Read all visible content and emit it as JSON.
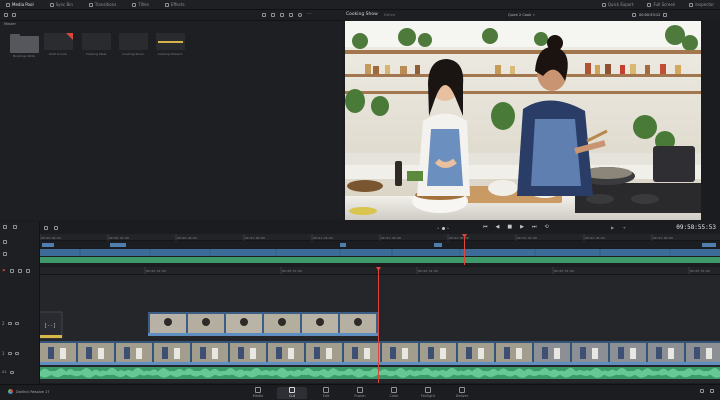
{
  "topbar": {
    "items": [
      {
        "label": "Media Pool",
        "active": true
      },
      {
        "label": "Sync Bin",
        "active": false
      },
      {
        "label": "Transitions",
        "active": false
      },
      {
        "label": "Titles",
        "active": false
      },
      {
        "label": "Effects",
        "active": false
      }
    ],
    "right_items": [
      {
        "label": "Quick Export"
      },
      {
        "label": "Full Screen"
      },
      {
        "label": "Inspector"
      }
    ]
  },
  "media_pool": {
    "bin_label": "Master",
    "clips": [
      {
        "label": "Bookings Wide",
        "type": "folder"
      },
      {
        "label": "Shot 4 Cook",
        "type": "red"
      },
      {
        "label": "Cooking Stew",
        "type": "dark"
      },
      {
        "label": "Cooking Show",
        "type": "dark"
      },
      {
        "label": "Cooking Show.m",
        "type": "audio"
      }
    ]
  },
  "viewer": {
    "title": "Cooking Show",
    "subtitle": "Edited",
    "zoom_select": "Quick 2 Cook",
    "source_timecode": "00:00:53:12",
    "record_timecode": "09:58:55:53",
    "controls": [
      "skip-back-icon",
      "step-back-icon",
      "stop-icon",
      "play-icon",
      "step-forward-icon",
      "loop-icon"
    ]
  },
  "timeline_ruler_upper": [
    "00:00:00:00",
    "00:00:20:00",
    "00:00:40:00",
    "00:01:00:00",
    "00:01:20:00",
    "00:01:40:00",
    "00:02:00:00",
    "00:02:20:00",
    "00:02:40:00",
    "00:03:00:00"
  ],
  "timeline_ruler_lower": [
    "00:00:52:00",
    "00:00:53:00",
    "00:00:54:00",
    "00:00:55:00",
    "00:00:56:00"
  ],
  "tracks": [
    {
      "id": "V2",
      "label": "2"
    },
    {
      "id": "V1",
      "label": "1"
    },
    {
      "id": "A1",
      "label": "A1"
    }
  ],
  "pagebar": {
    "app_name": "DaVinci Resolve 17",
    "pages": [
      {
        "label": "Media",
        "active": false
      },
      {
        "label": "Cut",
        "active": true
      },
      {
        "label": "Edit",
        "active": false
      },
      {
        "label": "Fusion",
        "active": false
      },
      {
        "label": "Color",
        "active": false
      },
      {
        "label": "Fairlight",
        "active": false
      },
      {
        "label": "Deliver",
        "active": false
      }
    ]
  },
  "colors": {
    "accent": "#e0453a",
    "video_clip": "#3f6f9c",
    "audio_clip": "#3fa06e",
    "title_clip": "#d9b84a"
  }
}
